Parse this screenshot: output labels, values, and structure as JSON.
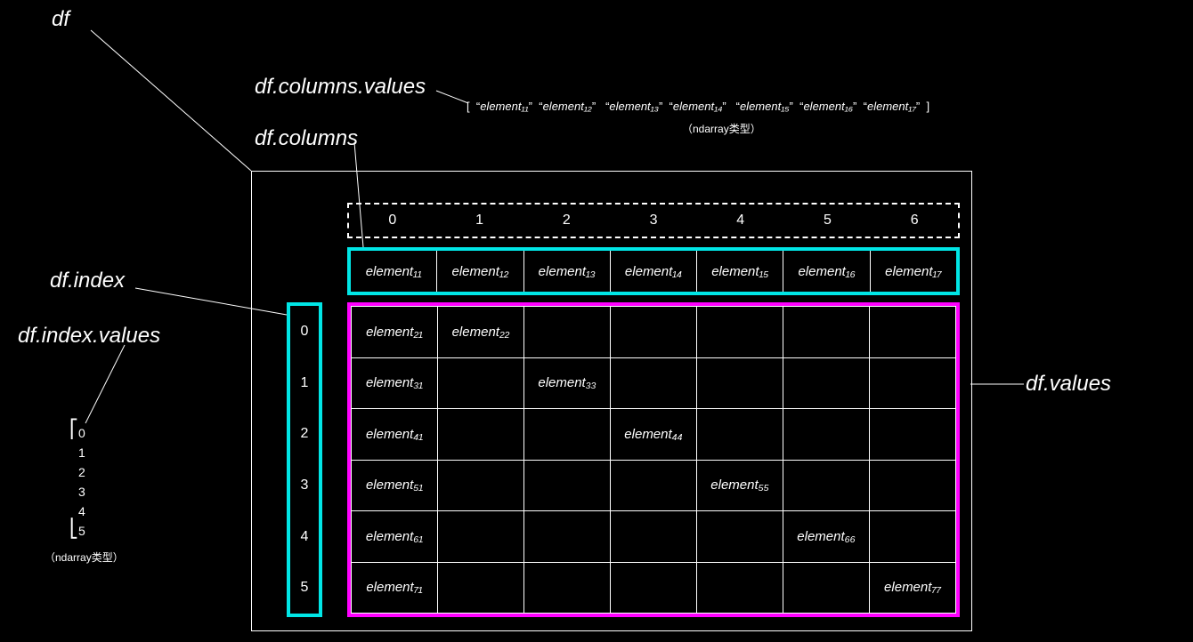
{
  "labels": {
    "df": "df",
    "df_columns_values": "df.columns.values",
    "df_columns": "df.columns",
    "df_index": "df.index",
    "df_index_values": "df.index.values",
    "df_values": "df.values",
    "ndarray_note": "（ndarray类型）",
    "ndarray_note2": "（ndarray类型）"
  },
  "col_positions": [
    "0",
    "1",
    "2",
    "3",
    "4",
    "5",
    "6"
  ],
  "header_cells": [
    "element₁₁",
    "element₁₂",
    "element₁₃",
    "element₁₄",
    "element₁₅",
    "element₁₆",
    "element₁₇"
  ],
  "index_cells": [
    "0",
    "1",
    "2",
    "3",
    "4",
    "5"
  ],
  "index_values_list": [
    "0",
    "1",
    "2",
    "3",
    "4",
    "5"
  ],
  "cols_values_array": [
    "element₁₁",
    "element₁₂",
    "element₁₃",
    "element₁₄",
    "element₁₅",
    "element₁₆",
    "element₁₇"
  ],
  "body": [
    [
      "element₂₁",
      "element₂₂",
      "",
      "",
      "",
      "",
      ""
    ],
    [
      "element₃₁",
      "",
      "element₃₃",
      "",
      "",
      "",
      ""
    ],
    [
      "element₄₁",
      "",
      "",
      "element₄₄",
      "",
      "",
      ""
    ],
    [
      "element₅₁",
      "",
      "",
      "",
      "element₅₅",
      "",
      ""
    ],
    [
      "element₆₁",
      "",
      "",
      "",
      "",
      "element₆₆",
      ""
    ],
    [
      "element₇₁",
      "",
      "",
      "",
      "",
      "",
      "element₇₇"
    ]
  ]
}
